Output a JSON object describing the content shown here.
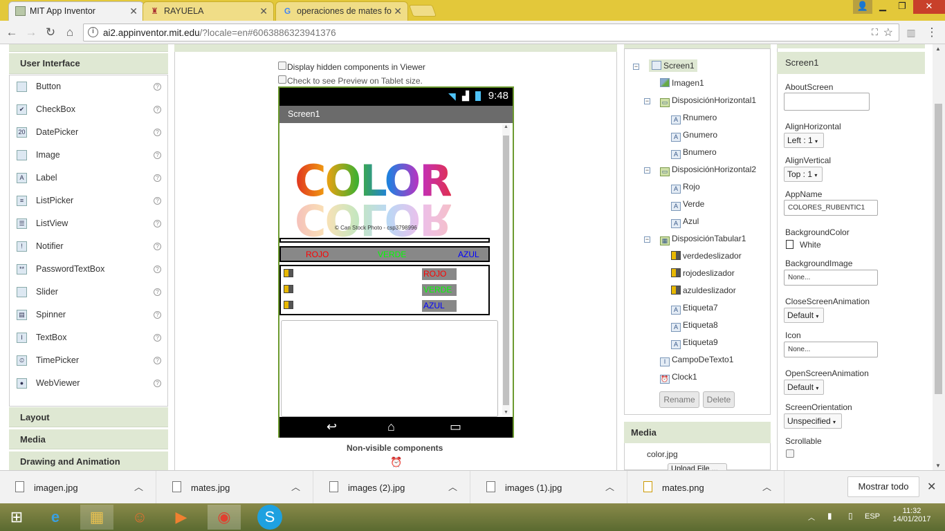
{
  "browser": {
    "tabs": [
      {
        "title": "MIT App Inventor",
        "active": true,
        "favicon": "app-inventor-icon"
      },
      {
        "title": "RAYUELA",
        "active": false,
        "favicon": "rayuela-icon"
      },
      {
        "title": "operaciones de mates fo",
        "active": false,
        "favicon": "google-icon"
      }
    ],
    "url_host": "ai2.appinventor.mit.edu",
    "url_rest": "/?locale=en#6063886323941376"
  },
  "palette": {
    "header": "User Interface",
    "items": [
      {
        "label": "Button",
        "icon": "button-icon",
        "glyph": ""
      },
      {
        "label": "CheckBox",
        "icon": "checkbox-icon",
        "glyph": "✔"
      },
      {
        "label": "DatePicker",
        "icon": "datepicker-icon",
        "glyph": "20"
      },
      {
        "label": "Image",
        "icon": "image-icon",
        "glyph": ""
      },
      {
        "label": "Label",
        "icon": "label-icon",
        "glyph": "A"
      },
      {
        "label": "ListPicker",
        "icon": "listpicker-icon",
        "glyph": "≡"
      },
      {
        "label": "ListView",
        "icon": "listview-icon",
        "glyph": "☰"
      },
      {
        "label": "Notifier",
        "icon": "notifier-icon",
        "glyph": "!"
      },
      {
        "label": "PasswordTextBox",
        "icon": "password-icon",
        "glyph": "**"
      },
      {
        "label": "Slider",
        "icon": "slider-icon",
        "glyph": ""
      },
      {
        "label": "Spinner",
        "icon": "spinner-icon",
        "glyph": "▤"
      },
      {
        "label": "TextBox",
        "icon": "textbox-icon",
        "glyph": "I"
      },
      {
        "label": "TimePicker",
        "icon": "timepicker-icon",
        "glyph": "⏲"
      },
      {
        "label": "WebViewer",
        "icon": "webviewer-icon",
        "glyph": "●"
      }
    ],
    "sections": [
      "Layout",
      "Media",
      "Drawing and Animation"
    ]
  },
  "viewer": {
    "display_hidden": "Display hidden components in Viewer",
    "tablet_preview": "Check to see Preview on Tablet size.",
    "time": "9:48",
    "screen_title": "Screen1",
    "image_word": "COLOR",
    "image_credit": "© Can Stock Photo - csp3798996",
    "labels_row": {
      "rojo": "ROJO",
      "verde": "VERDE",
      "azul": "AZUL"
    },
    "table_tags": [
      "ROJO",
      "VERDE",
      "AZUL"
    ],
    "nonvisible": "Non-visible components"
  },
  "components": {
    "nodes": [
      {
        "label": "Screen1",
        "indent": 0,
        "icon": "screen-icon",
        "selected": true,
        "toggle": "⊟"
      },
      {
        "label": "Imagen1",
        "indent": 1,
        "icon": "image-icon"
      },
      {
        "label": "DisposiciónHorizontal1",
        "indent": 1,
        "icon": "horizontal-arrangement-icon",
        "toggle": "⊟"
      },
      {
        "label": "Rnumero",
        "indent": 2,
        "icon": "label-icon"
      },
      {
        "label": "Gnumero",
        "indent": 2,
        "icon": "label-icon"
      },
      {
        "label": "Bnumero",
        "indent": 2,
        "icon": "label-icon"
      },
      {
        "label": "DisposiciónHorizontal2",
        "indent": 1,
        "icon": "horizontal-arrangement-icon",
        "toggle": "⊟"
      },
      {
        "label": "Rojo",
        "indent": 2,
        "icon": "label-icon"
      },
      {
        "label": "Verde",
        "indent": 2,
        "icon": "label-icon"
      },
      {
        "label": "Azul",
        "indent": 2,
        "icon": "label-icon"
      },
      {
        "label": "DisposiciónTabular1",
        "indent": 1,
        "icon": "table-arrangement-icon",
        "toggle": "⊟"
      },
      {
        "label": "verdedeslizador",
        "indent": 2,
        "icon": "slider-icon"
      },
      {
        "label": "rojodeslizador",
        "indent": 2,
        "icon": "slider-icon"
      },
      {
        "label": "azuldeslizador",
        "indent": 2,
        "icon": "slider-icon"
      },
      {
        "label": "Etiqueta7",
        "indent": 2,
        "icon": "label-icon"
      },
      {
        "label": "Etiqueta8",
        "indent": 2,
        "icon": "label-icon"
      },
      {
        "label": "Etiqueta9",
        "indent": 2,
        "icon": "label-icon"
      },
      {
        "label": "CampoDeTexto1",
        "indent": 1,
        "icon": "textbox-icon"
      },
      {
        "label": "Clock1",
        "indent": 1,
        "icon": "clock-icon"
      }
    ],
    "rename": "Rename",
    "delete": "Delete"
  },
  "media": {
    "header": "Media",
    "file": "color.jpg",
    "upload": "Upload File ..."
  },
  "properties": {
    "title": "Screen1",
    "about_label": "AboutScreen",
    "align_h_label": "AlignHorizontal",
    "align_h_value": "Left : 1",
    "align_v_label": "AlignVertical",
    "align_v_value": "Top : 1",
    "appname_label": "AppName",
    "appname_value": "COLORES_RUBENTIC1",
    "bgcolor_label": "BackgroundColor",
    "bgcolor_value": "White",
    "bgimage_label": "BackgroundImage",
    "bgimage_value": "None...",
    "close_anim_label": "CloseScreenAnimation",
    "close_anim_value": "Default",
    "icon_label": "Icon",
    "icon_value": "None...",
    "open_anim_label": "OpenScreenAnimation",
    "open_anim_value": "Default",
    "orientation_label": "ScreenOrientation",
    "orientation_value": "Unspecified",
    "scrollable_label": "Scrollable"
  },
  "downloads": {
    "items": [
      "imagen.jpg",
      "mates.jpg",
      "images (2).jpg",
      "images (1).jpg",
      "mates.png"
    ],
    "show_all": "Mostrar todo"
  },
  "taskbar": {
    "lang": "ESP",
    "time": "11:32",
    "date": "14/01/2017"
  },
  "colors": {
    "rojo": "#ff0000",
    "verde": "#00ff00",
    "azul": "#0000ff",
    "accent_green": "#6c9a2f",
    "panel_header": "#dfe8d3"
  }
}
